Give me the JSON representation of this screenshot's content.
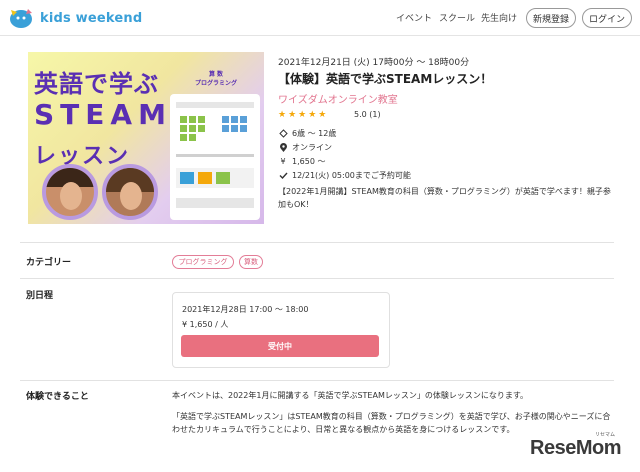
{
  "brand": {
    "name": "kids weekend"
  },
  "nav": {
    "events": "イベント",
    "school": "スクール",
    "teachers": "先生向け",
    "signup": "新規登録",
    "login": "ログイン"
  },
  "hero": {
    "title_line1": "英語で学ぶ",
    "title_line2": "STEAM",
    "title_line3": "レッスン",
    "panel_label_line1": "算 数",
    "panel_label_line2": "プログラミング"
  },
  "event": {
    "datetime": "2021年12月21日 (火) 17時00分 ～ 18時00分",
    "title": "【体験】英語で学ぶSTEAMレッスン！",
    "organizer": "ワイズダムオンライン教室",
    "stars": "★★★★★",
    "rating": "5.0 (1)",
    "age": "6歳 ～ 12歳",
    "location": "オンライン",
    "price": "1,650 ～",
    "deadline": "12/21(火) 05:00までご予約可能",
    "description": "【2022年1月開講】STEAM教育の科目（算数・プログラミング）が英語で学べます！親子参加もOK！"
  },
  "sections": {
    "category_label": "カテゴリー",
    "categories": [
      "プログラミング",
      "算数"
    ],
    "alt_schedule_label": "別日程",
    "alt_schedule": {
      "datetime": "2021年12月28日 17:00 ～ 18:00",
      "price": "¥ 1,650 / 人",
      "button": "受付中"
    },
    "experience_label": "体験できること",
    "experience_p1": "本イベントは、2022年1月に開講する「英語で学ぶSTEAMレッスン」の体験レッスンになります。",
    "experience_p2": "「英語で学ぶSTEAMレッスン」はSTEAM教育の科目（算数・プログラミング）を英語で学び、お子様の関心やニーズに合わせたカリキュラムで行うことにより、日常と異なる観点から英語を身につけるレッスンです。"
  },
  "watermark": {
    "text": "ReseMom",
    "sub": "リセマム"
  },
  "colors": {
    "accent": "#3aa0d8",
    "pink": "#e2758f",
    "star": "#f4a80b",
    "button": "#e9707f"
  }
}
